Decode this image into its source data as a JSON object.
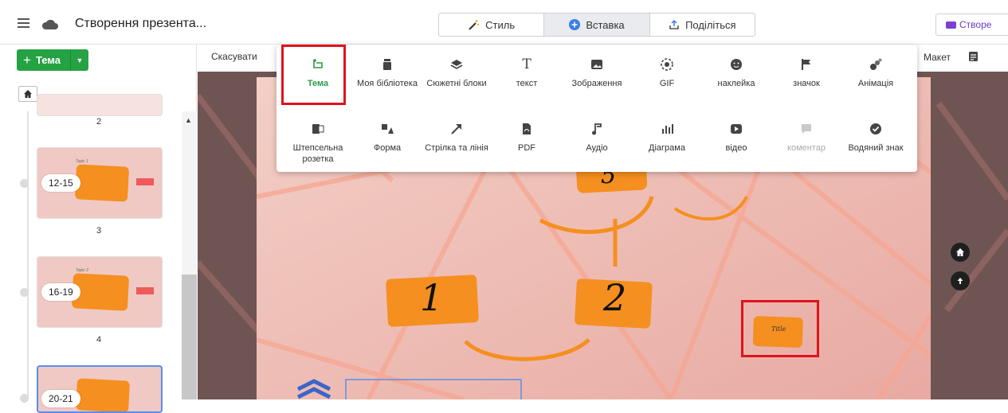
{
  "header": {
    "doc_title": "Створення презента...",
    "tabs": [
      {
        "label": "Стиль",
        "icon": "magic-wand-icon"
      },
      {
        "label": "Вставка",
        "icon": "plus-circle-icon"
      },
      {
        "label": "Поділіться",
        "icon": "share-icon"
      }
    ],
    "create_label": "Створе"
  },
  "sidebar": {
    "tema_button": "Тема",
    "slides": [
      {
        "number": "2"
      },
      {
        "range": "12-15",
        "number": "3"
      },
      {
        "range": "16-19",
        "number": "4"
      },
      {
        "range": "20-21"
      }
    ]
  },
  "subbar": {
    "cancel": "Скасувати",
    "layout": "Макет"
  },
  "insert_panel": {
    "row1": [
      {
        "label": "Тема",
        "icon": "topic-icon"
      },
      {
        "label": "Моя бібліотека",
        "icon": "library-icon"
      },
      {
        "label": "Сюжетні блоки",
        "icon": "layers-icon"
      },
      {
        "label": "текст",
        "icon": "text-icon"
      },
      {
        "label": "Зображення",
        "icon": "image-icon"
      },
      {
        "label": "GIF",
        "icon": "gif-icon"
      },
      {
        "label": "наклейка",
        "icon": "sticker-icon"
      },
      {
        "label": "значок",
        "icon": "flag-icon"
      },
      {
        "label": "Анімація",
        "icon": "animation-icon"
      }
    ],
    "row2": [
      {
        "label": "Штепсельна розетка",
        "icon": "plug-icon"
      },
      {
        "label": "Форма",
        "icon": "shape-icon"
      },
      {
        "label": "Стрілка та лінія",
        "icon": "arrow-icon"
      },
      {
        "label": "PDF",
        "icon": "pdf-icon"
      },
      {
        "label": "Аудіо",
        "icon": "music-icon"
      },
      {
        "label": "Діаграма",
        "icon": "chart-icon"
      },
      {
        "label": "відео",
        "icon": "video-icon"
      },
      {
        "label": "коментар",
        "icon": "comment-icon"
      },
      {
        "label": "Водяний знак",
        "icon": "watermark-icon"
      }
    ]
  },
  "slide": {
    "box1": "1",
    "box2": "2",
    "box_top": "5",
    "small_box": "Title"
  },
  "colors": {
    "accent_green": "#25a244",
    "orange": "#f58f1f",
    "highlight_red": "#e0131c"
  }
}
